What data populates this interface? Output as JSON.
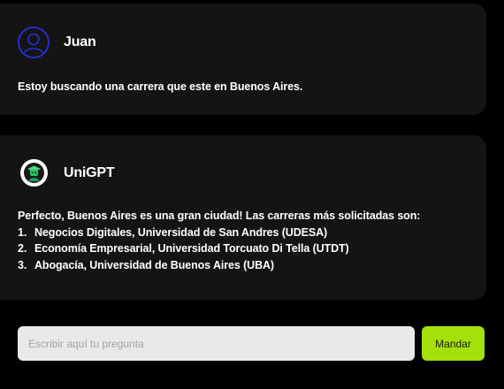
{
  "user_message": {
    "name": "Juan",
    "avatar_icon": "user-circle-icon",
    "avatar_color": "#2430c9",
    "text": "Estoy buscando una carrera que este en Buenos Aires."
  },
  "bot_message": {
    "name": "UniGPT",
    "avatar_icon": "graduate-robot-icon",
    "intro": "Perfecto, Buenos Aires es una gran ciudad! Las carreras más solicitadas son:",
    "items": [
      {
        "num": "1.",
        "text": "Negocios Digitales, Universidad de San Andres (UDESA)"
      },
      {
        "num": "2.",
        "text": "Economía Empresarial, Universidad Torcuato Di Tella (UTDT)"
      },
      {
        "num": "3.",
        "text": "Abogacía, Universidad de Buenos Aires (UBA)"
      }
    ]
  },
  "composer": {
    "placeholder": "Escribir aquí tu pregunta",
    "value": "",
    "send_label": "Mandar",
    "send_color": "#a4e00a"
  }
}
